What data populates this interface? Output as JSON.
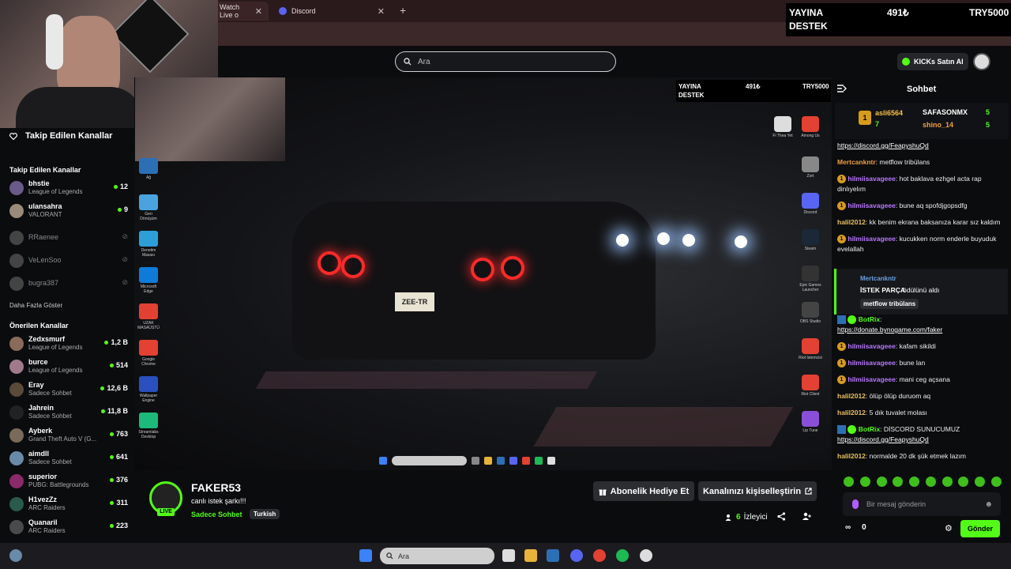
{
  "browser": {
    "tabs": [
      {
        "label": "Watch Live o"
      },
      {
        "label": "Discord"
      }
    ],
    "new_tab": "+",
    "close": "✕"
  },
  "header": {
    "search_placeholder": "Ara",
    "kicks_button": "KICKs Satın Al"
  },
  "donate": {
    "left_top": "YAYINA",
    "left_bottom": "DESTEK",
    "amount": "491₺",
    "target": "TRY5000"
  },
  "sidebar": {
    "title": "Takip Edilen Kanallar",
    "followed_heading": "Takip Edilen Kanallar",
    "followed": [
      {
        "name": "bhstie",
        "game": "League of Legends",
        "viewers": "12",
        "color": "#6a5a8a"
      },
      {
        "name": "ulansahra",
        "game": "VALORANT",
        "viewers": "9",
        "color": "#9a8a7a"
      }
    ],
    "offline": [
      {
        "name": "RRaenee"
      },
      {
        "name": "VeLenSoo"
      },
      {
        "name": "bugra387"
      }
    ],
    "show_more": "Daha Fazla Göster",
    "recommended_heading": "Önerilen Kanallar",
    "recommended": [
      {
        "name": "Zedxsmurf",
        "game": "League of Legends",
        "viewers": "1,2 B",
        "color": "#8a6a5a"
      },
      {
        "name": "burce",
        "game": "League of Legends",
        "viewers": "514",
        "color": "#a07a8a"
      },
      {
        "name": "Eray",
        "game": "Sadece Sohbet",
        "viewers": "12,6 B",
        "color": "#5a4a3a"
      },
      {
        "name": "Jahrein",
        "game": "Sadece Sohbet",
        "viewers": "11,8 B",
        "color": "#222222"
      },
      {
        "name": "Ayberk",
        "game": "Grand Theft Auto V (G...",
        "viewers": "763",
        "color": "#7a6a5a"
      },
      {
        "name": "aimdll",
        "game": "Sadece Sohbet",
        "viewers": "641",
        "color": "#6a8aaa"
      },
      {
        "name": "superior",
        "game": "PUBG: Battlegrounds",
        "viewers": "376",
        "color": "#8a2a6a"
      },
      {
        "name": "H1vezZz",
        "game": "ARC Raiders",
        "viewers": "311",
        "color": "#2a5a4a"
      },
      {
        "name": "Quanaril",
        "game": "ARC Raiders",
        "viewers": "223",
        "color": "#4a4a4a"
      }
    ]
  },
  "overlay": {
    "donate_left_top": "YAYINA",
    "donate_left_bottom": "DESTEK",
    "donate_amount": "491₺",
    "donate_target": "TRY5000",
    "plate": "ZEE-TR",
    "desktop_icons": [
      "Ağ",
      "Geri Dönüşüm",
      "Denetim Masası",
      "Microsoft Edge",
      "UZAK MASAÜSTÜ",
      "Google Chrome",
      "Wallpaper Engine",
      "Streamlabs Desktop"
    ],
    "right_icons": [
      "Fi Thea Yet",
      "Among Us",
      "Zort",
      "Discord",
      "Steam",
      "Epic Games Launcher",
      "OBS Studio",
      "Riot Istemcisi",
      "Riot Client",
      "Lip Tune"
    ],
    "taskbar_search": "Ara"
  },
  "stream": {
    "channel": "FAKER53",
    "live_label": "LIVE",
    "title": "canlı istek şarkı!!!",
    "category": "Sadece Sohbet",
    "language_tag": "Turkish",
    "sub_gift_button": "Abonelik Hediye Et",
    "customize_button": "Kanalınızı kişiselleştirin",
    "viewer_count": "6",
    "viewer_label": "İzleyici"
  },
  "chat": {
    "title": "Sohbet",
    "leaderboard": [
      {
        "rank": "1",
        "name": "asli6564",
        "count": "7"
      },
      {
        "name": "SAFASONMX",
        "count": "5"
      },
      {
        "name": "shino_14",
        "count": "5"
      }
    ],
    "messages": [
      {
        "user": "",
        "text": "https://discord.gg/FeapyshuQd",
        "link": true
      },
      {
        "user": "Mertcankntr",
        "color": "#f0a040",
        "text": "metflow tribülans"
      },
      {
        "user": "hilmiisavageee",
        "color": "#b878ff",
        "badge": true,
        "text": "hot baklava ezhgel acta rap dinlıyelım"
      },
      {
        "user": "hilmiisavageee",
        "color": "#b878ff",
        "badge": true,
        "text": "bune aq spofdjgopsdfg"
      },
      {
        "user": "halil2012",
        "color": "#e8c060",
        "text": "kk benim ekrana baksanıza karar sız kaldım"
      },
      {
        "user": "hilmiisavageee",
        "color": "#b878ff",
        "badge": true,
        "text": "kucukken norm enderle buyuduk evelallah"
      }
    ],
    "redeem": {
      "user": "Mertcankntr",
      "action_bold": "İSTEK PARÇA",
      "action": "ödülünü aldı",
      "reward": "metflow tribülans"
    },
    "messages2": [
      {
        "user": "BotRix",
        "color": "#53fc18",
        "bot": true,
        "text": "",
        "link_text": "https://donate.bynogame.com/faker"
      },
      {
        "user": "hilmiisavageee",
        "color": "#b878ff",
        "badge": true,
        "text": "kafam sikildi"
      },
      {
        "user": "hilmiisavageee",
        "color": "#b878ff",
        "badge": true,
        "text": "bune lan"
      },
      {
        "user": "hilmiisavageee",
        "color": "#b878ff",
        "badge": true,
        "text": "mani ceg açsana"
      },
      {
        "user": "halil2012",
        "color": "#e8c060",
        "text": "ölüp ölüp duruom aq"
      },
      {
        "user": "halil2012",
        "color": "#e8c060",
        "text": "5 dık tuvalet molası"
      },
      {
        "user": "BotRix",
        "color": "#53fc18",
        "bot": true,
        "text": "DİSCORD SUNUCUMUZ",
        "link_text": "https://discord.gg/FeapyshuQd"
      },
      {
        "user": "halil2012",
        "color": "#e8c060",
        "text": "normalde 20 dk şük etmek lazım"
      }
    ],
    "input_placeholder": "Bir mesaj gönderin",
    "footer_points": "0",
    "send_button": "Gönder"
  },
  "colors": {
    "accent": "#53fc18",
    "bg": "#0b0c0e",
    "panel": "#2b2d31"
  }
}
